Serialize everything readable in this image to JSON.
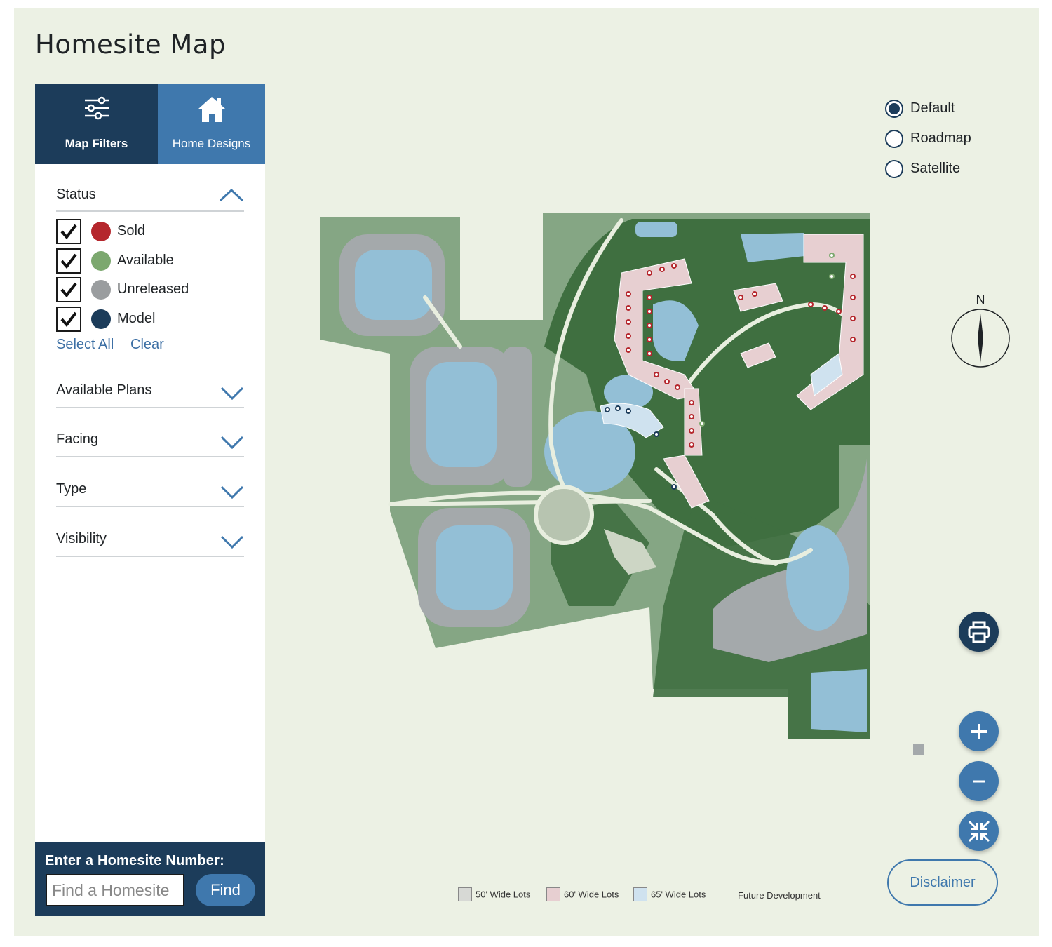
{
  "page": {
    "title": "Homesite Map"
  },
  "tabs": {
    "filters": {
      "label": "Map Filters",
      "icon": "sliders-icon"
    },
    "designs": {
      "label": "Home Designs",
      "icon": "house-icon"
    }
  },
  "status": {
    "title": "Status",
    "items": [
      {
        "label": "Sold",
        "color": "#b5272d",
        "checked": true
      },
      {
        "label": "Available",
        "color": "#7ca86f",
        "checked": true
      },
      {
        "label": "Unreleased",
        "color": "#9a9d9f",
        "checked": true
      },
      {
        "label": "Model",
        "color": "#1c3c5a",
        "checked": true
      }
    ],
    "select_all": "Select All",
    "clear": "Clear"
  },
  "sections": [
    {
      "label": "Available Plans"
    },
    {
      "label": "Facing"
    },
    {
      "label": "Type"
    },
    {
      "label": "Visibility"
    }
  ],
  "search": {
    "label": "Enter a Homesite Number:",
    "placeholder": "Find a Homesite",
    "button": "Find"
  },
  "map_types": [
    {
      "label": "Default",
      "selected": true
    },
    {
      "label": "Roadmap",
      "selected": false
    },
    {
      "label": "Satellite",
      "selected": false
    }
  ],
  "compass": {
    "label": "N"
  },
  "controls": {
    "print": "printer-icon",
    "zoom_in": "plus-icon",
    "zoom_out": "minus-icon",
    "reset": "compress-icon"
  },
  "disclaimer": "Disclaimer",
  "legend": [
    {
      "label": "50' Wide Lots",
      "color": "#d7d9d5"
    },
    {
      "label": "60' Wide Lots",
      "color": "#e7cfd1"
    },
    {
      "label": "65' Wide Lots",
      "color": "#cfe2ef"
    },
    {
      "label": "Future Development",
      "color": ""
    }
  ],
  "colors": {
    "navy": "#1c3c5a",
    "accent": "#3f78ad",
    "background": "#ecf1e4",
    "forest": "#3d6e3f",
    "water": "#93bfd6",
    "lots": "#a4a9ab"
  }
}
